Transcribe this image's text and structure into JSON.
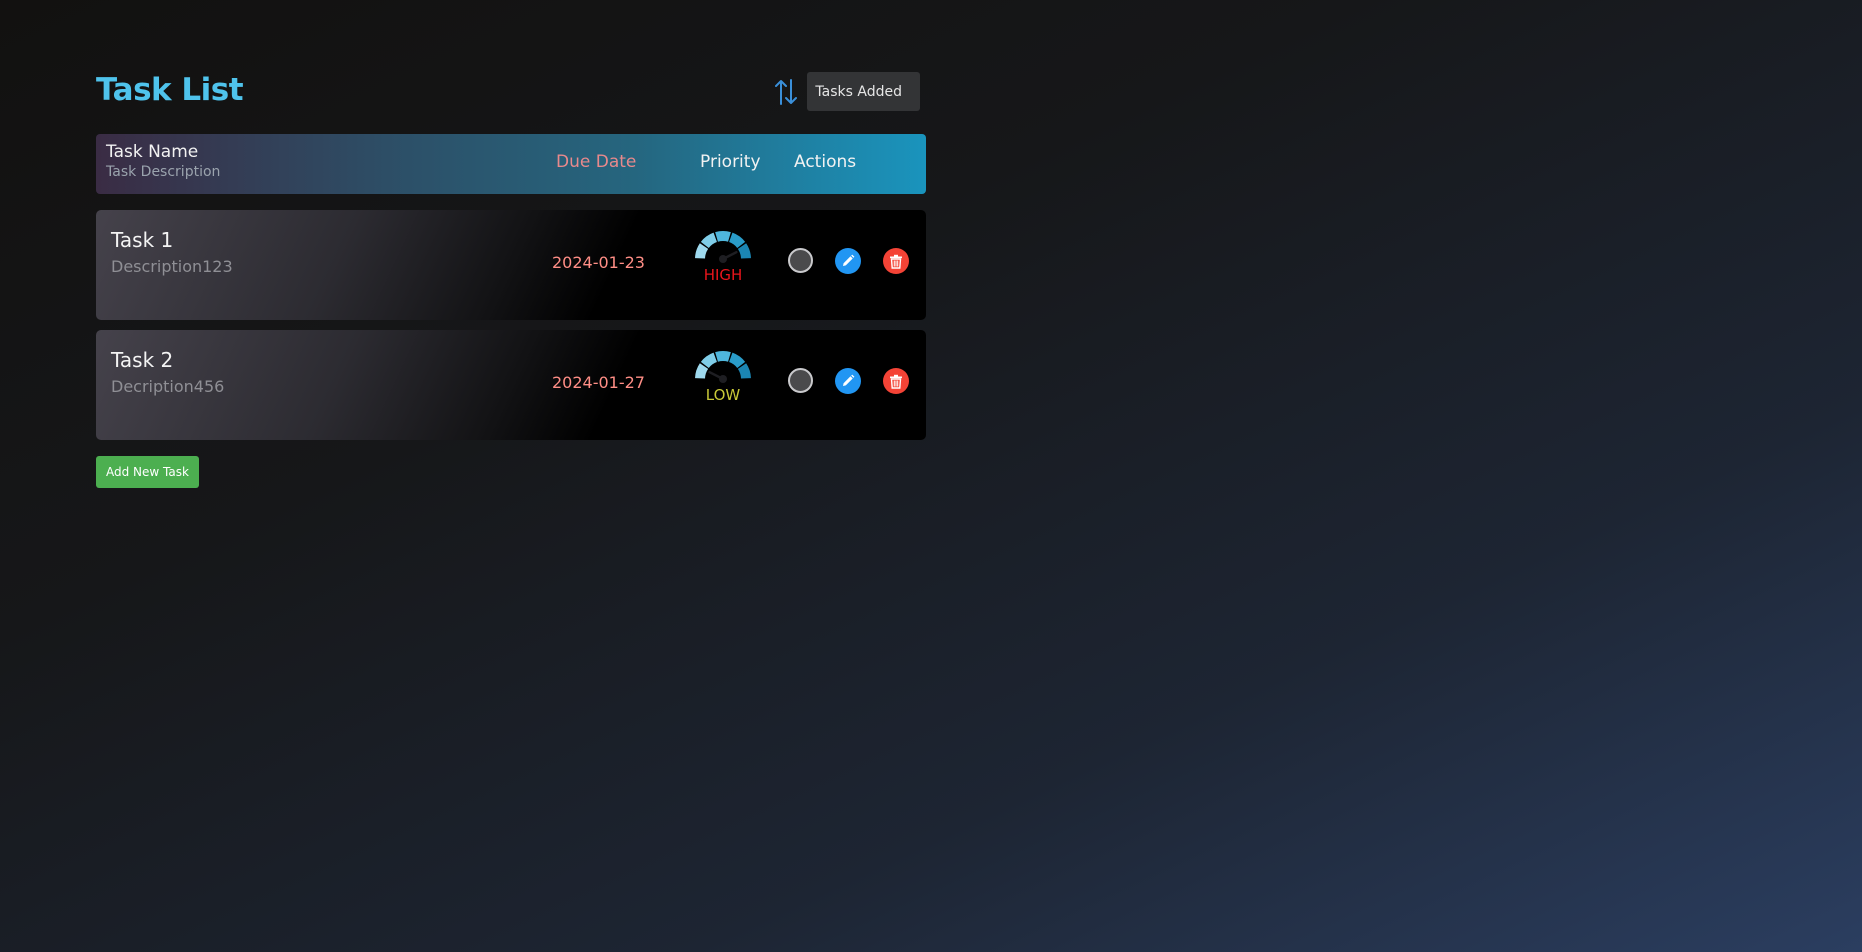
{
  "header": {
    "title": "Task List",
    "sort_icon": "sort-arrows-icon",
    "sort_value": "Tasks Added"
  },
  "table_header": {
    "name": "Task Name",
    "description": "Task Description",
    "due_date": "Due Date",
    "priority": "Priority",
    "actions": "Actions"
  },
  "tasks": [
    {
      "name": "Task 1",
      "description": "Description123",
      "due_date": "2024-01-23",
      "priority": "HIGH",
      "priority_color": "#e8151b",
      "gauge_level": 0.85
    },
    {
      "name": "Task 2",
      "description": "Decription456",
      "due_date": "2024-01-27",
      "priority": "LOW",
      "priority_color": "#c8c838",
      "gauge_level": 0.15
    }
  ],
  "action_icons": {
    "complete": "circle-toggle-icon",
    "edit": "pencil-icon",
    "delete": "trash-icon"
  },
  "add_button": "Add New Task",
  "colors": {
    "title": "#4fc3ec",
    "edit": "#2196f3",
    "delete": "#f44336",
    "add": "#4caf50",
    "due_date": "#ff8e86"
  }
}
